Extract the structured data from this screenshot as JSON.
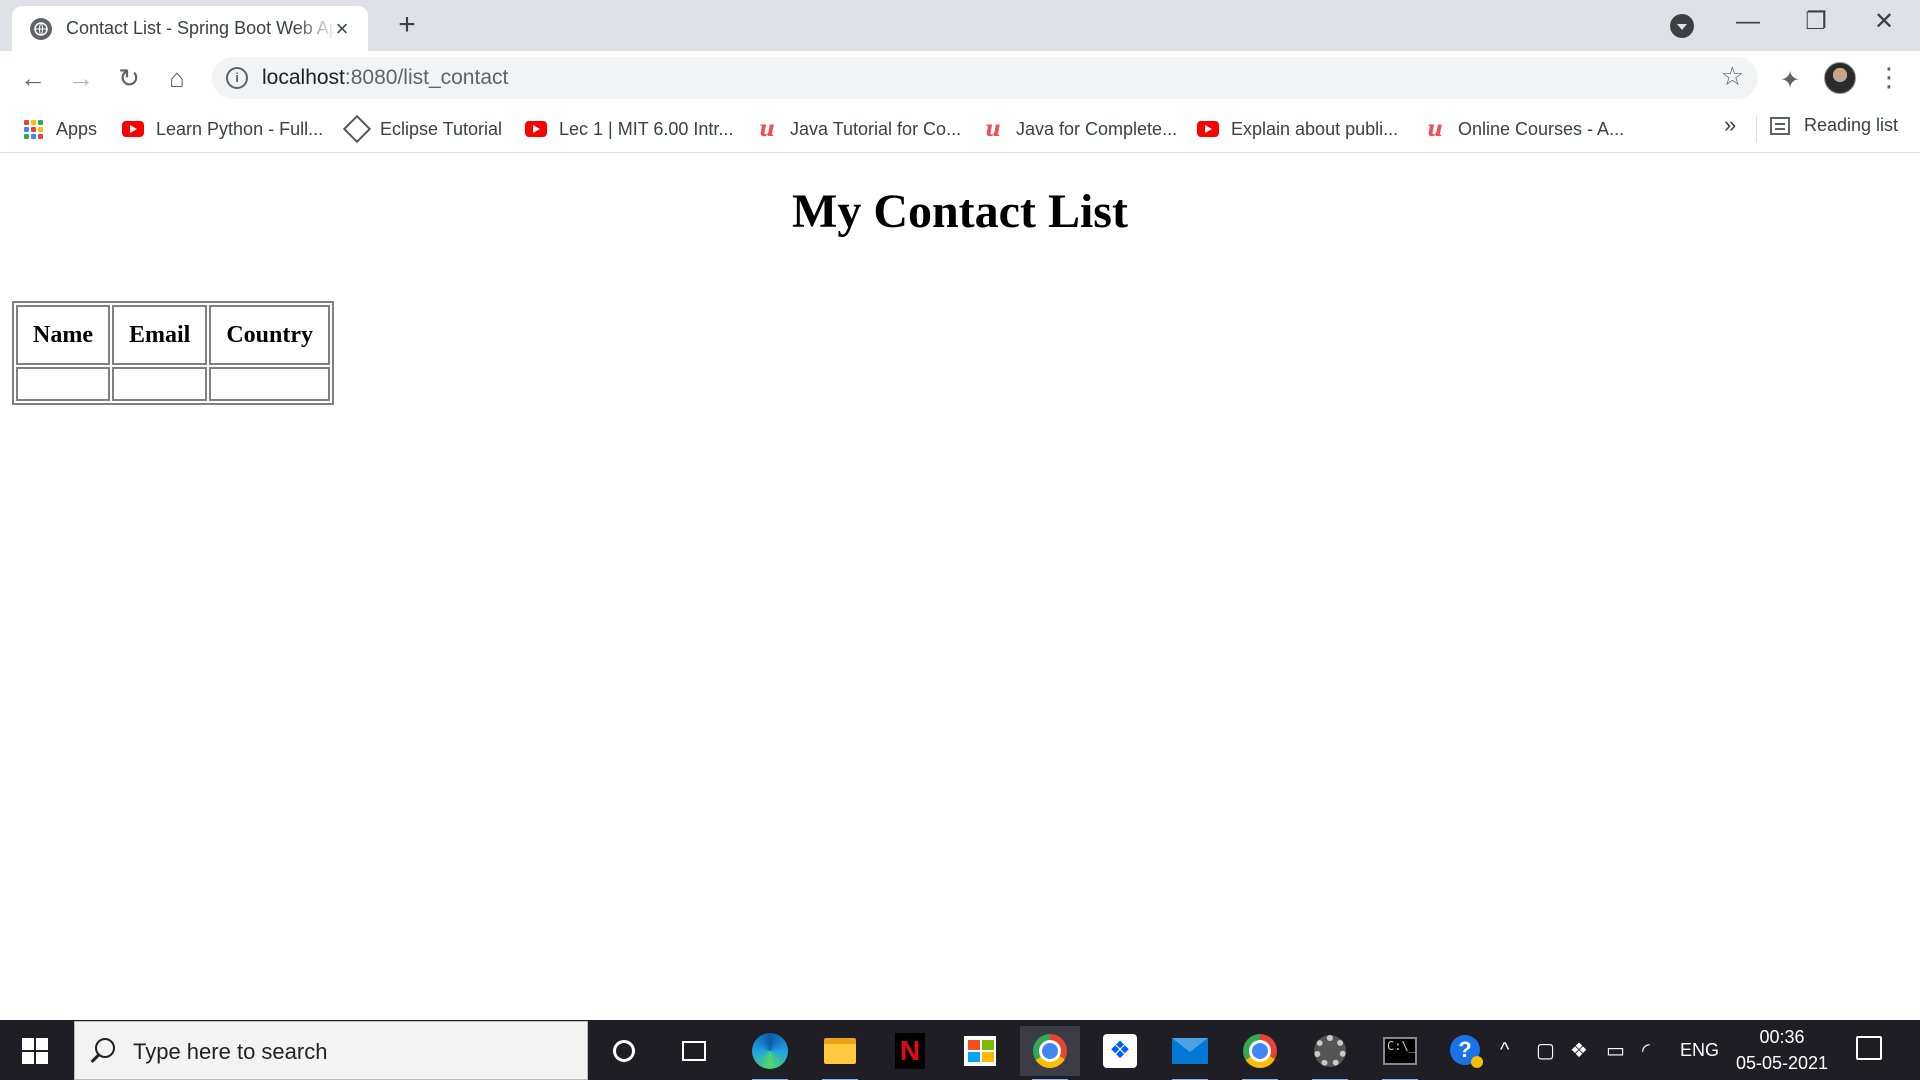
{
  "browser": {
    "tab_title": "Contact List - Spring Boot Web Application",
    "tab_close": "×",
    "new_tab": "+",
    "window_controls": {
      "minimize": "—",
      "restore": "❐",
      "close": "✕"
    },
    "nav": {
      "back": "←",
      "forward": "→",
      "reload": "↻",
      "home": "⌂"
    },
    "url_host": "localhost",
    "url_path": ":8080/list_contact",
    "bookmark_star": "☆",
    "extensions": "✦",
    "menu": "⋮",
    "bookmarks": [
      {
        "label": "Apps",
        "icon": "apps-grid-icon"
      },
      {
        "label": "Learn Python - Full...",
        "icon": "youtube-icon"
      },
      {
        "label": "Eclipse Tutorial",
        "icon": "eclipse-icon"
      },
      {
        "label": "Lec 1 | MIT 6.00 Intr...",
        "icon": "youtube-icon"
      },
      {
        "label": "Java Tutorial for Co...",
        "icon": "udemy-icon"
      },
      {
        "label": "Java for Complete...",
        "icon": "udemy-icon"
      },
      {
        "label": "Explain about publi...",
        "icon": "youtube-icon"
      },
      {
        "label": "Online Courses - A...",
        "icon": "udemy-icon"
      }
    ],
    "more_bookmarks": "»",
    "reading_list": "Reading list"
  },
  "page": {
    "heading": "My Contact List",
    "table": {
      "headers": [
        "Name",
        "Email",
        "Country"
      ],
      "rows": [
        [
          "",
          "",
          ""
        ]
      ]
    }
  },
  "taskbar": {
    "search_placeholder": "Type here to search",
    "netflix_letter": "N",
    "dropbox_glyph": "❖",
    "terminal_glyph": "C:\\_",
    "help_glyph": "?",
    "tray_chevron": "^",
    "language": "ENG",
    "time": "00:36",
    "date": "05-05-2021"
  },
  "colors": {
    "tabstrip": "#dee1e6",
    "taskbar": "#1e1e24",
    "apps_grid": [
      "#ea4335",
      "#fbbc05",
      "#34a853",
      "#4285f4",
      "#ea4335",
      "#fbbc05",
      "#34a853",
      "#4285f4",
      "#ea4335"
    ]
  }
}
